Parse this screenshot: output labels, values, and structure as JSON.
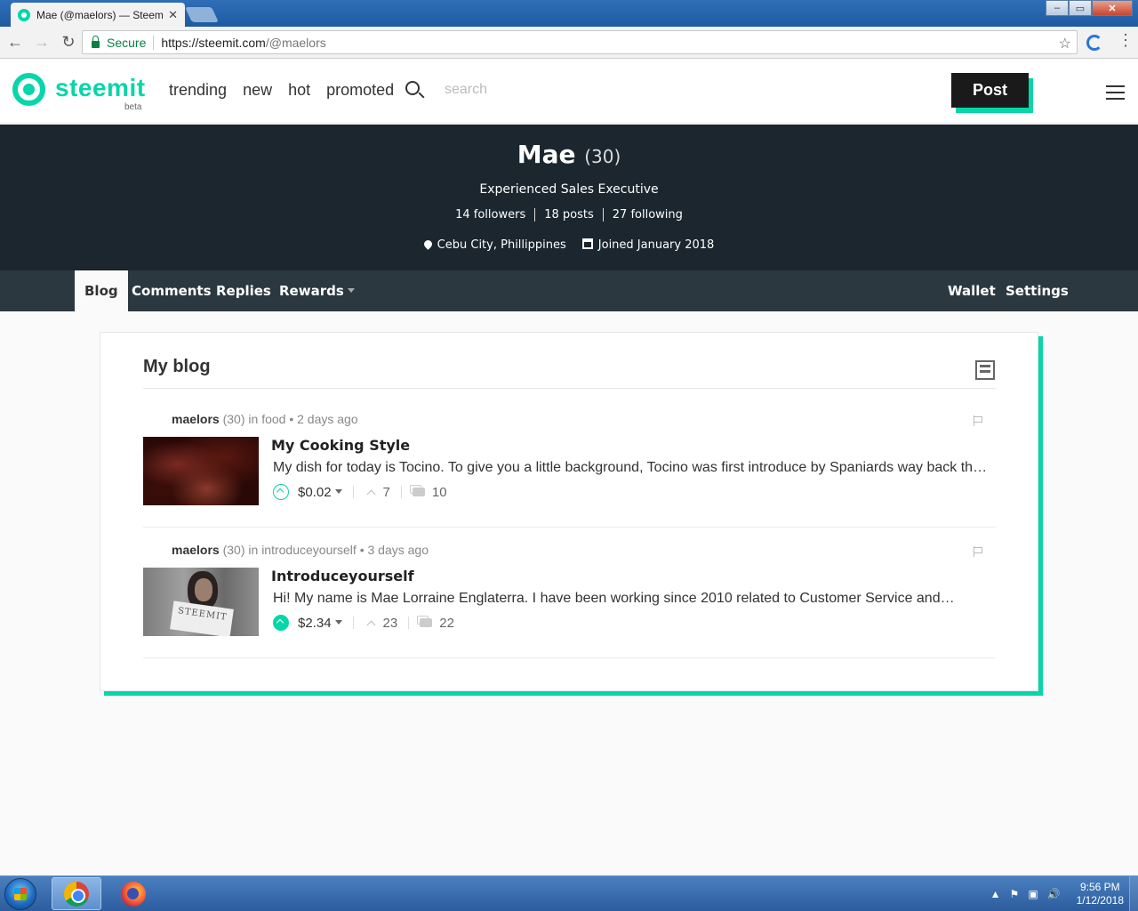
{
  "browser": {
    "tab_title": "Mae (@maelors) — Steemit",
    "tab_close": "✕",
    "secure_label": "Secure",
    "url_host": "https://steemit.com",
    "url_path": "/@maelors",
    "back_glyph": "←",
    "forward_glyph": "→",
    "reload_glyph": "↻",
    "star_glyph": "☆",
    "menu_glyph": "⋮",
    "win_min": "‒",
    "win_max": "▭",
    "win_close": "✕"
  },
  "header": {
    "logo_text": "steemit",
    "logo_beta": "beta",
    "nav": [
      "trending",
      "new",
      "hot",
      "promoted"
    ],
    "search_placeholder": "search",
    "post_button": "Post"
  },
  "profile": {
    "name": "Mae",
    "reputation": "(30)",
    "about": "Experienced Sales Executive",
    "followers": "14 followers",
    "posts": "18 posts",
    "following": "27 following",
    "location": "Cebu City, Phillippines",
    "joined": "Joined January 2018"
  },
  "profile_tabs": {
    "blog": "Blog",
    "comments": "Comments",
    "replies": "Replies",
    "rewards": "Rewards",
    "wallet": "Wallet",
    "settings": "Settings"
  },
  "blog": {
    "title": "My blog",
    "posts": [
      {
        "author": "maelors",
        "rep": "(30)",
        "in_label": "in",
        "category": "food",
        "age": "• 2 days ago",
        "title": "My Cooking Style",
        "body": "My dish for today is Tocino. To give you a little background, Tocino was first introduce by Spaniards way back th…",
        "payout": "$0.02",
        "votes": "7",
        "comments": "10",
        "voted": false
      },
      {
        "author": "maelors",
        "rep": "(30)",
        "in_label": "in",
        "category": "introduceyourself",
        "age": "• 3 days ago",
        "title": "Introduceyourself",
        "body": "Hi! My name is Mae Lorraine Englaterra. I have been working since 2010 related to Customer Service and…",
        "payout": "$2.34",
        "votes": "23",
        "comments": "22",
        "voted": true,
        "thumb_sign_text": "STEEMIT"
      }
    ]
  },
  "taskbar": {
    "tray_up": "▲",
    "tray_flag": "⚑",
    "tray_network": "▣",
    "tray_volume": "🔊",
    "time": "9:56 PM",
    "date": "1/12/2018"
  },
  "colors": {
    "accent": "#06d6a9",
    "banner_bg": "#1b262e",
    "tabs_bg": "#2c3840"
  }
}
